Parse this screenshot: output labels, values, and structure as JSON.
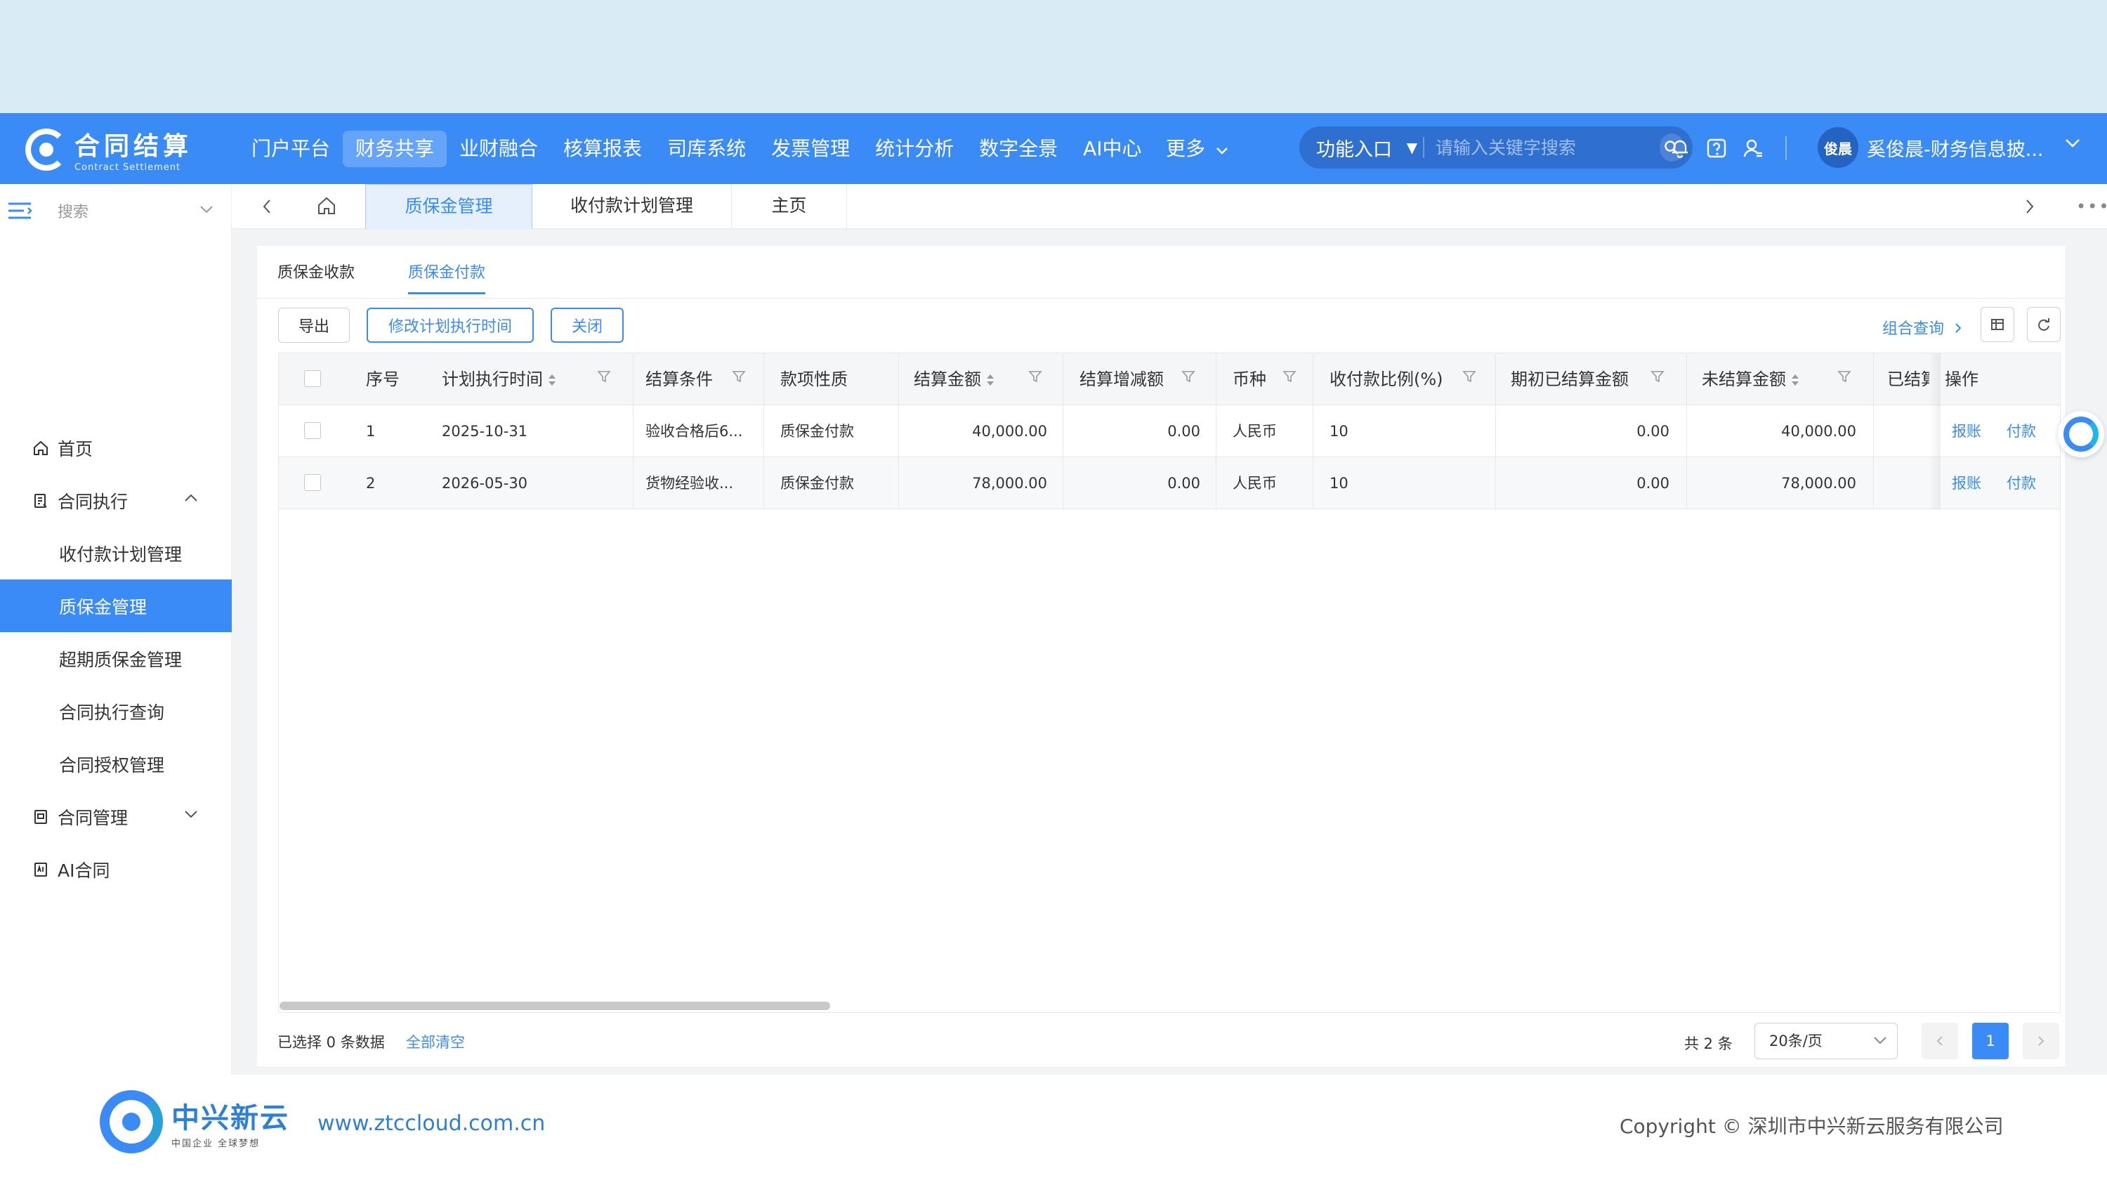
{
  "header": {
    "logo_title": "合同结算",
    "logo_sub": "Contract Settlement",
    "nav": [
      "门户平台",
      "财务共享",
      "业财融合",
      "核算报表",
      "司库系统",
      "发票管理",
      "统计分析",
      "数字全景",
      "AI中心"
    ],
    "nav_active_index": 1,
    "more": "更多",
    "func_entry": "功能入口",
    "search_placeholder": "请输入关键字搜索",
    "avatar_text": "俊晨",
    "user_name": "奚俊晨-财务信息披..."
  },
  "sidebar": {
    "search_placeholder": "搜索",
    "items": [
      {
        "label": "首页"
      },
      {
        "label": "合同执行"
      },
      {
        "label": "收付款计划管理"
      },
      {
        "label": "质保金管理"
      },
      {
        "label": "超期质保金管理"
      },
      {
        "label": "合同执行查询"
      },
      {
        "label": "合同授权管理"
      },
      {
        "label": "合同管理"
      },
      {
        "label": "AI合同"
      }
    ]
  },
  "tabs": [
    "质保金管理",
    "收付款计划管理",
    "主页"
  ],
  "subtabs": [
    "质保金收款",
    "质保金付款"
  ],
  "toolbar": {
    "export": "导出",
    "modify_time": "修改计划执行时间",
    "close": "关闭",
    "combo_query": "组合查询"
  },
  "table": {
    "headers": [
      "序号",
      "计划执行时间",
      "结算条件",
      "款项性质",
      "结算金额",
      "结算增减额",
      "币种",
      "收付款比例(%)",
      "期初已结算金额",
      "未结算金额",
      "已结算",
      "操作"
    ],
    "rows": [
      {
        "no": "1",
        "time": "2025-10-31",
        "cond": "验收合格后6...",
        "nature": "质保金付款",
        "amount": "40,000.00",
        "delta": "0.00",
        "currency": "人民币",
        "ratio": "10",
        "initial": "0.00",
        "unsettled": "40,000.00"
      },
      {
        "no": "2",
        "time": "2026-05-30",
        "cond": "货物经验收...",
        "nature": "质保金付款",
        "amount": "78,000.00",
        "delta": "0.00",
        "currency": "人民币",
        "ratio": "10",
        "initial": "0.00",
        "unsettled": "78,000.00"
      }
    ],
    "op_reimburse": "报账",
    "op_pay": "付款"
  },
  "footer_bar": {
    "selected": "已选择 0 条数据",
    "clear_all": "全部清空",
    "total": "共 2 条",
    "page_size": "20条/页",
    "current_page": "1"
  },
  "page_footer": {
    "brand": "中兴新云",
    "slogan": "中国企业 全球梦想",
    "url": "www.ztccloud.com.cn",
    "copyright": "Copyright © 深圳市中兴新云服务有限公司"
  },
  "colors": {
    "primary": "#3a8bf6",
    "header_bg": "#3a8bf6",
    "top_band": "#d9ebf5"
  }
}
